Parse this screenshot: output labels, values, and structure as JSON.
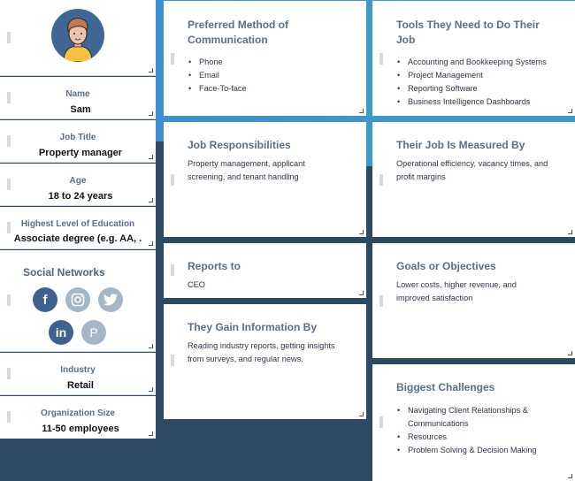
{
  "profile": {
    "avatar": "person-avatar-icon",
    "fields": [
      {
        "label": "Name",
        "value": "Sam"
      },
      {
        "label": "Job Title",
        "value": "Property manager"
      },
      {
        "label": "Age",
        "value": "18 to 24 years"
      },
      {
        "label": "Highest Level of Education",
        "value": "Associate degree (e.g. AA, ."
      },
      {
        "label": "Industry",
        "value": "Retail"
      },
      {
        "label": "Organization Size",
        "value": "11-50 employees"
      }
    ],
    "social": {
      "title": "Social Networks",
      "networks": [
        {
          "name": "facebook",
          "glyph": "f",
          "active": true
        },
        {
          "name": "instagram",
          "glyph": "◎",
          "active": false
        },
        {
          "name": "twitter",
          "glyph": "🐦",
          "active": false
        },
        {
          "name": "linkedin",
          "glyph": "in",
          "active": true
        },
        {
          "name": "pinterest",
          "glyph": "P",
          "active": false
        }
      ]
    }
  },
  "cards": {
    "communication": {
      "title": "Preferred Method of Communication",
      "items": [
        "Phone",
        "Email",
        "Face-To-face"
      ]
    },
    "tools": {
      "title": "Tools They Need to Do Their Job",
      "items": [
        "Accounting and Bookkeeping Systems",
        "Project Management",
        "Reporting Software",
        "Business Intelligence Dashboards"
      ]
    },
    "responsibilities": {
      "title": "Job Responsibilities",
      "text": "Property management, applicant screening, and tenant handling"
    },
    "measured": {
      "title": "Their Job Is Measured By",
      "text": "Operational efficiency, vacancy times, and profit margins"
    },
    "reports_to": {
      "title": "Reports to",
      "text": "CEO"
    },
    "goals": {
      "title": "Goals or Objectives",
      "text": "Lower costs, higher revenue, and improved satisfaction"
    },
    "information": {
      "title": "They Gain Information By",
      "text": "Reading industry reports, getting insights from surveys, and regular news."
    },
    "challenges": {
      "title": "Biggest Challenges",
      "items": [
        "Navigating Client Relationships & Communications",
        "Resources",
        "Problem Solving & Decision Making"
      ]
    }
  },
  "colors": {
    "background_dark": "#2e4a62",
    "background_blue": "#3f8fd2",
    "heading": "#5a6f86",
    "social_active": "#3f6190",
    "social_inactive": "#a6b6c9"
  }
}
